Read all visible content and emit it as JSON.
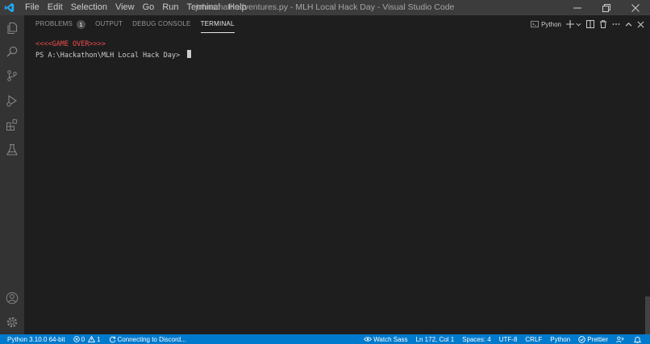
{
  "window": {
    "title": "johnsmathadventures.py - MLH Local Hack Day - Visual Studio Code",
    "menu": [
      "File",
      "Edit",
      "Selection",
      "View",
      "Go",
      "Run",
      "Terminal",
      "Help"
    ]
  },
  "activity_bar": {
    "items": [
      "explorer-icon",
      "search-icon",
      "source-control-icon",
      "run-debug-icon",
      "extensions-icon",
      "testing-icon"
    ],
    "bottom": [
      "account-icon",
      "manage-gear-icon"
    ]
  },
  "panel": {
    "tabs": [
      {
        "label": "PROBLEMS",
        "badge": "1",
        "active": false
      },
      {
        "label": "OUTPUT",
        "active": false
      },
      {
        "label": "DEBUG CONSOLE",
        "active": false
      },
      {
        "label": "TERMINAL",
        "active": true
      }
    ],
    "shell_label": "Python"
  },
  "terminal": {
    "lines": [
      "<<<<GAME OVER>>>>",
      "PS A:\\Hackathon\\MLH Local Hack Day> "
    ]
  },
  "status_bar": {
    "interpreter": "Python 3.10.0 64-bit",
    "errors": "0",
    "warnings": "1",
    "discord": "Connecting to Discord...",
    "watch_sass": "Watch Sass",
    "cursor_position": "Ln 172, Col 1",
    "indentation": "Spaces: 4",
    "encoding": "UTF-8",
    "eol": "CRLF",
    "language": "Python",
    "prettier": "Prettier"
  },
  "colors": {
    "titlebar": "#3c3c3c",
    "activitybar": "#333333",
    "panel": "#1e1e1e",
    "statusbar": "#007acc",
    "game_over_text": "#f14c4c"
  }
}
